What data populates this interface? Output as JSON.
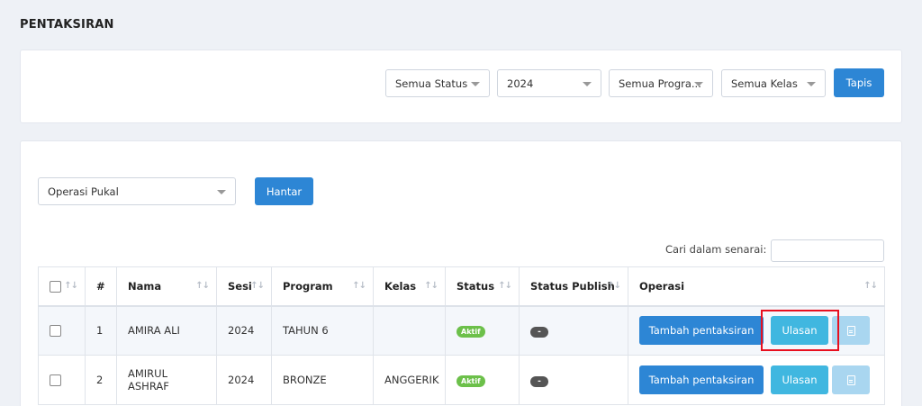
{
  "page": {
    "title": "PENTAKSIRAN"
  },
  "filters": {
    "status": "Semua Status",
    "year": "2024",
    "program": "Semua Progra...",
    "kelas": "Semua Kelas",
    "submit_label": "Tapis"
  },
  "bulk": {
    "select_value": "Operasi Pukal",
    "submit_label": "Hantar"
  },
  "search": {
    "label": "Cari dalam senarai:",
    "value": ""
  },
  "table": {
    "headers": [
      "#",
      "Nama",
      "Sesi",
      "Program",
      "Kelas",
      "Status",
      "Status Publish",
      "Operasi"
    ],
    "rows": [
      {
        "no": "1",
        "nama": "AMIRA ALI",
        "sesi": "2024",
        "program": "TAHUN 6",
        "kelas": "",
        "status": "Aktif",
        "publish": "-"
      },
      {
        "no": "2",
        "nama": "AMIRUL ASHRAF",
        "sesi": "2024",
        "program": "BRONZE",
        "kelas": "ANGGERIK",
        "status": "Aktif",
        "publish": "-"
      }
    ],
    "actions": {
      "add": "Tambah pentaksiran",
      "review": "Ulasan"
    }
  },
  "icons": {
    "sort": "sort-icon",
    "document": "document-icon",
    "caret": "caret-down-icon"
  },
  "colors": {
    "primary": "#2d86d5",
    "info": "#40b7e0",
    "success": "#6cc04a",
    "highlight": "#e8101f"
  }
}
